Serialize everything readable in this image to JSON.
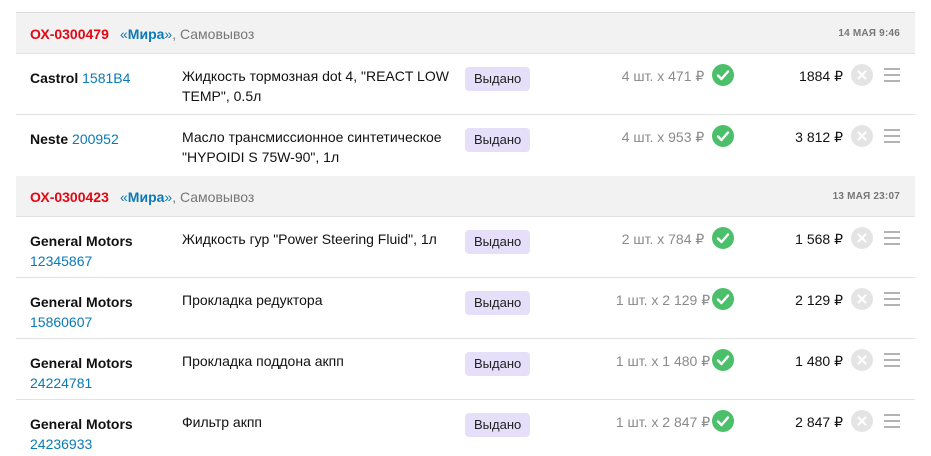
{
  "orders": [
    {
      "number": "ОХ-0300479",
      "store_open_quote": "«",
      "store_name": "Мира",
      "store_close_quote": "»",
      "delivery": ", Самовывоз",
      "date": "14 МАЯ 9:46",
      "items": [
        {
          "brand": "Castrol",
          "article": "1581B4",
          "name": "Жидкость тормозная dot 4, \"REACT LOW TEMP\", 0.5л",
          "status": "Выдано",
          "qty": "4 шт. x 471 ₽",
          "total": "1884 ₽"
        },
        {
          "brand": "Neste",
          "article": "200952",
          "name": "Масло трансмиссионное синтетическое \"HYPOIDI S 75W-90\", 1л",
          "status": "Выдано",
          "qty": "4 шт. x 953 ₽",
          "total": "3 812 ₽"
        }
      ]
    },
    {
      "number": "ОХ-0300423",
      "store_open_quote": "«",
      "store_name": "Мира",
      "store_close_quote": "»",
      "delivery": ", Самовывоз",
      "date": "13 МАЯ 23:07",
      "items": [
        {
          "brand": "General Motors",
          "article": "12345867",
          "name": "Жидкость гур \"Power Steering Fluid\", 1л",
          "status": "Выдано",
          "qty": "2 шт. x 784 ₽",
          "total": "1 568 ₽"
        },
        {
          "brand": "General Motors",
          "article": "15860607",
          "name": "Прокладка редуктора",
          "status": "Выдано",
          "qty": "1 шт. x 2 129 ₽",
          "total": "2 129 ₽"
        },
        {
          "brand": "General Motors",
          "article": "24224781",
          "name": "Прокладка поддона акпп",
          "status": "Выдано",
          "qty": "1 шт. x 1 480 ₽",
          "total": "1 480 ₽"
        },
        {
          "brand": "General Motors",
          "article": "24236933",
          "name": "Фильтр акпп",
          "status": "Выдано",
          "qty": "1 шт. x 2 847 ₽",
          "total": "2 847 ₽"
        }
      ]
    }
  ],
  "icons": {
    "confirm": "check-circle-icon",
    "cancel": "cancel-circle-icon",
    "menu": "hamburger-menu-icon"
  },
  "colors": {
    "order_number": "#e30613",
    "link": "#0b7ab5",
    "status_badge": "#e6dffa",
    "check": "#4cbf6b",
    "cancel": "#e4e4e4"
  }
}
